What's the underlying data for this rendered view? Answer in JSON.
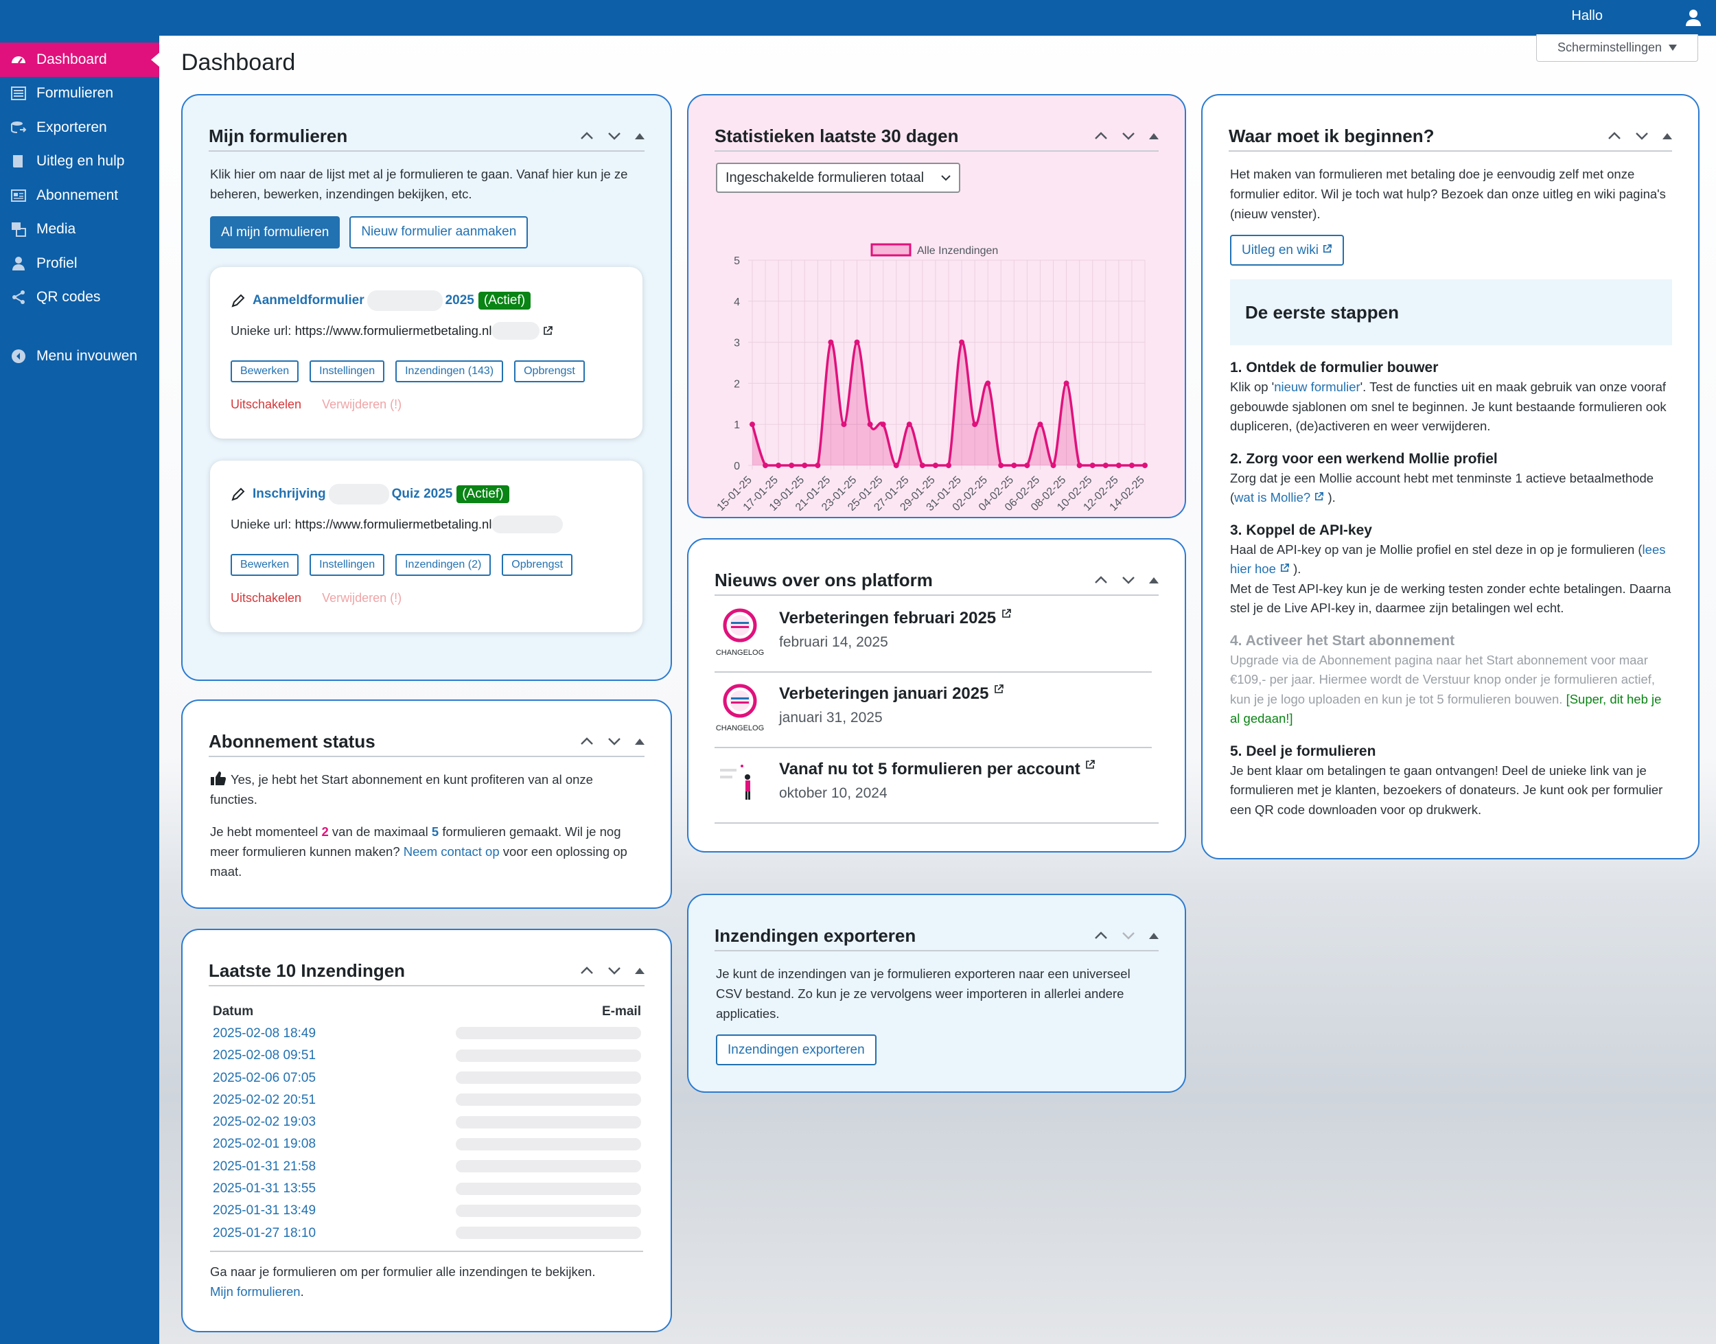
{
  "topbar": {
    "greeting": "Hallo"
  },
  "sidebar": {
    "items": [
      {
        "label": "Dashboard",
        "icon": "dashboard-icon"
      },
      {
        "label": "Formulieren",
        "icon": "forms-icon"
      },
      {
        "label": "Exporteren",
        "icon": "export-icon"
      },
      {
        "label": "Uitleg en hulp",
        "icon": "book-icon"
      },
      {
        "label": "Abonnement",
        "icon": "subscription-icon"
      },
      {
        "label": "Media",
        "icon": "media-icon"
      },
      {
        "label": "Profiel",
        "icon": "user-icon"
      },
      {
        "label": "QR codes",
        "icon": "share-icon"
      }
    ],
    "collapse_label": "Menu invouwen"
  },
  "page": {
    "title": "Dashboard",
    "screen_options": "Scherminstellingen"
  },
  "forms_widget": {
    "title": "Mijn formulieren",
    "intro": "Klik hier om naar de lijst met al je formulieren te gaan. Vanaf hier kun je ze beheren, bewerken, inzendingen bekijken, etc.",
    "all_button": "Al mijn formulieren",
    "new_button": "Nieuw formulier aanmaken",
    "forms": [
      {
        "name_start": "Aanmeldformulier",
        "name_end": "2025",
        "status": "(Actief)",
        "url_label": "Unieke url:",
        "url": "https://www.formuliermetbetaling.nl",
        "buttons": [
          "Bewerken",
          "Instellingen",
          "Inzendingen (143)",
          "Opbrengst"
        ],
        "disable": "Uitschakelen",
        "delete": "Verwijderen (!)"
      },
      {
        "name_start": "Inschrijving",
        "name_end": "Quiz 2025",
        "status": "(Actief)",
        "url_label": "Unieke url:",
        "url": "https://www.formuliermetbetaling.nl",
        "buttons": [
          "Bewerken",
          "Instellingen",
          "Inzendingen (2)",
          "Opbrengst"
        ],
        "disable": "Uitschakelen",
        "delete": "Verwijderen (!)"
      }
    ]
  },
  "subscription_widget": {
    "title": "Abonnement status",
    "line1": "Yes, je hebt het Start abonnement en kunt profiteren van al onze functies.",
    "line2_a": "Je hebt momenteel ",
    "current": "2",
    "line2_b": " van de maximaal ",
    "max": "5",
    "line2_c": " formulieren gemaakt. Wil je nog meer formulieren kunnen maken? ",
    "contact_link": "Neem contact op",
    "line2_d": " voor een oplossing op maat."
  },
  "submissions_widget": {
    "title": "Laatste 10 Inzendingen",
    "col_date": "Datum",
    "col_email": "E-mail",
    "rows": [
      "2025-02-08 18:49",
      "2025-02-08 09:51",
      "2025-02-06 07:05",
      "2025-02-02 20:51",
      "2025-02-02 19:03",
      "2025-02-01 19:08",
      "2025-01-31 21:58",
      "2025-01-31 13:55",
      "2025-01-31 13:49",
      "2025-01-27 18:10"
    ],
    "footer_text": "Ga naar je formulieren om per formulier alle inzendingen te bekijken.",
    "footer_link": "Mijn formulieren"
  },
  "stats_widget": {
    "title": "Statistieken laatste 30 dagen",
    "select_value": "Ingeschakelde formulieren totaal"
  },
  "chart_data": {
    "type": "area",
    "series": [
      {
        "name": "Alle Inzendingen",
        "color": "#e0117c",
        "values": [
          1,
          0,
          0,
          0,
          0,
          0,
          3,
          1,
          3,
          1,
          1,
          0,
          1,
          0,
          0,
          0,
          3,
          1,
          2,
          0,
          0,
          0,
          1,
          0,
          2,
          0,
          0,
          0,
          0,
          0,
          0
        ]
      }
    ],
    "x": [
      "15-01-25",
      "16-01-25",
      "17-01-25",
      "18-01-25",
      "19-01-25",
      "20-01-25",
      "21-01-25",
      "22-01-25",
      "23-01-25",
      "24-01-25",
      "25-01-25",
      "26-01-25",
      "27-01-25",
      "28-01-25",
      "29-01-25",
      "30-01-25",
      "31-01-25",
      "01-02-25",
      "02-02-25",
      "03-02-25",
      "04-02-25",
      "05-02-25",
      "06-02-25",
      "07-02-25",
      "08-02-25",
      "09-02-25",
      "10-02-25",
      "11-02-25",
      "12-02-25",
      "13-02-25",
      "14-02-25"
    ],
    "x_tick_labels": [
      "15-01-25",
      "17-01-25",
      "19-01-25",
      "21-01-25",
      "23-01-25",
      "25-01-25",
      "27-01-25",
      "29-01-25",
      "31-01-25",
      "02-02-25",
      "04-02-25",
      "06-02-25",
      "08-02-25",
      "10-02-25",
      "12-02-25",
      "14-02-25"
    ],
    "y_ticks": [
      "0",
      "1",
      "2",
      "3",
      "4",
      "5"
    ],
    "ylim": [
      0,
      5
    ],
    "grid": true,
    "legend_position": "top-center"
  },
  "news_widget": {
    "title": "Nieuws over ons platform",
    "logo_caption": "CHANGELOG",
    "items": [
      {
        "title": "Verbeteringen februari 2025",
        "date": "februari 14, 2025"
      },
      {
        "title": "Verbeteringen januari 2025",
        "date": "januari 31, 2025"
      },
      {
        "title": "Vanaf nu tot 5 formulieren per account",
        "date": "oktober 10, 2024"
      }
    ]
  },
  "export_widget": {
    "title": "Inzendingen exporteren",
    "text": "Je kunt de inzendingen van je formulieren exporteren naar een universeel CSV bestand. Zo kun je ze vervolgens weer importeren in allerlei andere applicaties.",
    "button": "Inzendingen exporteren"
  },
  "start_widget": {
    "title": "Waar moet ik beginnen?",
    "intro": "Het maken van formulieren met betaling doe je eenvoudig zelf met onze formulier editor. Wil je toch wat hulp? Bezoek dan onze uitleg en wiki pagina's (nieuw venster).",
    "wiki_button": "Uitleg en wiki",
    "steps_title": "De eerste stappen",
    "step1_title": "1. Ontdek de formulier bouwer",
    "step1_a": "Klik op '",
    "step1_link": "nieuw formulier",
    "step1_b": "'. Test de functies uit en maak gebruik van onze vooraf gebouwde sjablonen om snel te beginnen. Je kunt bestaande formulieren ook dupliceren, (de)activeren en weer verwijderen.",
    "step2_title": "2. Zorg voor een werkend Mollie profiel",
    "step2_a": "Zorg dat je een Mollie account hebt met tenminste 1 actieve betaalmethode (",
    "step2_link": "wat is Mollie?",
    "step2_b": ").",
    "step3_title": "3. Koppel de API-key",
    "step3_a": "Haal de API-key op van je Mollie profiel en stel deze in op je formulieren (",
    "step3_link": "lees hier hoe",
    "step3_b": ").",
    "step3_c": "Met de Test API-key kun je de werking testen zonder echte betalingen. Daarna stel je de Live API-key in, daarmee zijn betalingen wel echt.",
    "step4_title": "4. Activeer het Start abonnement",
    "step4_a": "Upgrade via de ",
    "step4_link": "Abonnement",
    "step4_b": " pagina naar het Start abonnement voor maar €109,- per jaar. Hiermee wordt de Verstuur knop onder je formulieren actief, kun je je logo uploaden en kun je tot 5 formulieren bouwen. ",
    "step4_done": "[Super, dit heb je al gedaan!]",
    "step5_title": "5. Deel je formulieren",
    "step5_text": "Je bent klaar om betalingen te gaan ontvangen! Deel de unieke link van je formulieren met je klanten, bezoekers of donateurs. Je kunt ook per formulier een QR code downloaden voor op drukwerk."
  }
}
